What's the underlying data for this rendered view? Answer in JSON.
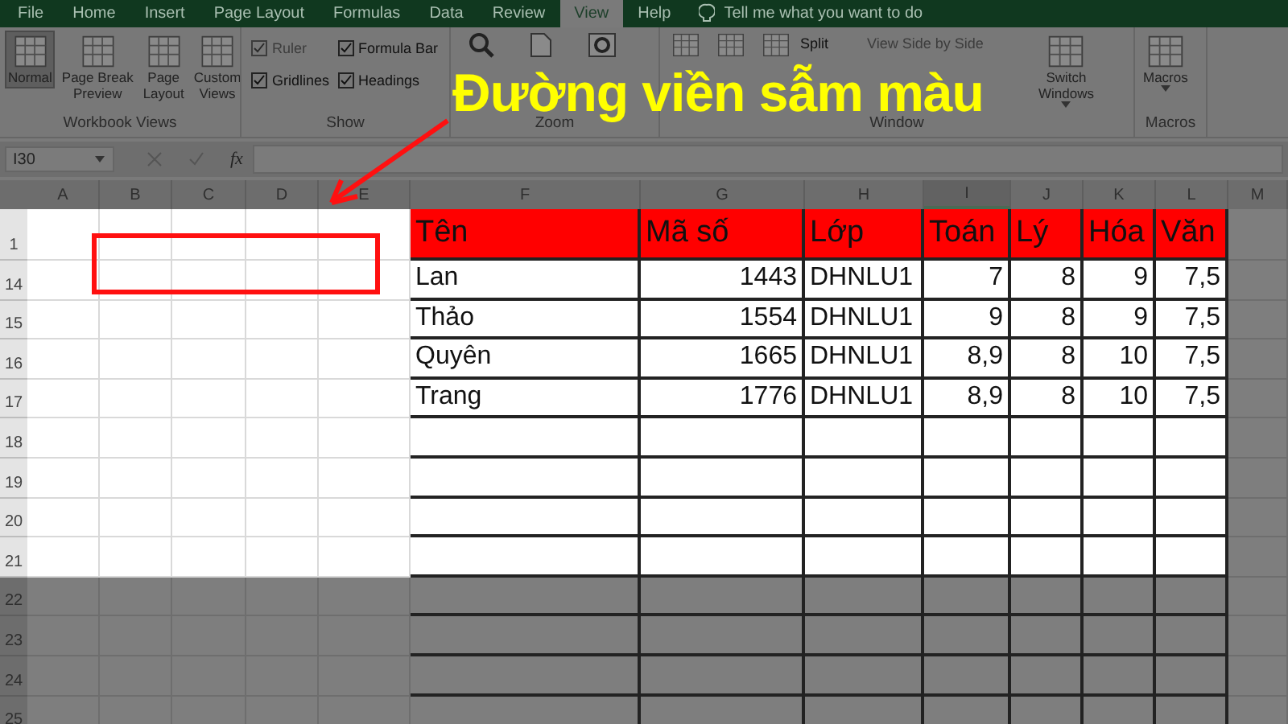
{
  "tabs": [
    {
      "label": "File",
      "selected": false
    },
    {
      "label": "Home",
      "selected": false
    },
    {
      "label": "Insert",
      "selected": false
    },
    {
      "label": "Page Layout",
      "selected": false
    },
    {
      "label": "Formulas",
      "selected": false
    },
    {
      "label": "Data",
      "selected": false
    },
    {
      "label": "Review",
      "selected": false
    },
    {
      "label": "View",
      "selected": true
    },
    {
      "label": "Help",
      "selected": false
    }
  ],
  "tell_me": {
    "placeholder": "Tell me what you want to do"
  },
  "ribbon": {
    "groups": [
      {
        "kind": "views",
        "label": "Workbook Views",
        "items": [
          {
            "lines": [
              "Normal"
            ],
            "selected": true
          },
          {
            "lines": [
              "Page Break",
              "Preview"
            ],
            "selected": false
          },
          {
            "lines": [
              "Page",
              "Layout"
            ],
            "selected": false
          },
          {
            "lines": [
              "Custom",
              "Views"
            ],
            "selected": false
          }
        ]
      },
      {
        "kind": "checks",
        "label": "Show",
        "items": [
          {
            "label": "Ruler",
            "checked": true,
            "disabled": true
          },
          {
            "label": "Formula Bar",
            "checked": true,
            "disabled": false
          },
          {
            "label": "Gridlines",
            "checked": true,
            "disabled": false
          },
          {
            "label": "Headings",
            "checked": true,
            "disabled": false
          }
        ]
      },
      {
        "kind": "zoom",
        "label": "Zoom"
      },
      {
        "kind": "window",
        "label": "Window",
        "items": [
          {
            "label": "Split",
            "disabled": false
          },
          {
            "label": "View Side by Side",
            "disabled": true
          }
        ],
        "button": {
          "lines": [
            "Switch",
            "Windows"
          ]
        }
      },
      {
        "kind": "macros",
        "label": "Macros",
        "button": {
          "lines": [
            "Macros"
          ]
        }
      }
    ]
  },
  "formula_bar": {
    "name_box": "I30",
    "function_label": "fx"
  },
  "columns": [
    {
      "label": "A",
      "selected": false
    },
    {
      "label": "B",
      "selected": false
    },
    {
      "label": "C",
      "selected": false
    },
    {
      "label": "D",
      "selected": false
    },
    {
      "label": "E",
      "selected": false
    },
    {
      "label": "F",
      "selected": false
    },
    {
      "label": "G",
      "selected": false
    },
    {
      "label": "H",
      "selected": false
    },
    {
      "label": "I",
      "selected": true
    },
    {
      "label": "J",
      "selected": false
    },
    {
      "label": "K",
      "selected": false
    },
    {
      "label": "L",
      "selected": false
    },
    {
      "label": "M",
      "selected": false
    }
  ],
  "rows": [
    {
      "label": "1",
      "kind": "header",
      "dimmed": false,
      "cells": [
        "Tên",
        "Mã số",
        "Lớp",
        "Toán",
        "Lý",
        "Hóa",
        "Văn"
      ]
    },
    {
      "label": "14",
      "kind": "data",
      "dimmed": false,
      "cells": [
        "Lan",
        "1443",
        "DHNLU1",
        "7",
        "8",
        "9",
        "7,5"
      ]
    },
    {
      "label": "15",
      "kind": "data",
      "dimmed": false,
      "cells": [
        "Thảo",
        "1554",
        "DHNLU1",
        "9",
        "8",
        "9",
        "7,5"
      ]
    },
    {
      "label": "16",
      "kind": "data",
      "dimmed": false,
      "cells": [
        "Quyên",
        "1665",
        "DHNLU1",
        "8,9",
        "8",
        "10",
        "7,5"
      ]
    },
    {
      "label": "17",
      "kind": "data",
      "dimmed": false,
      "cells": [
        "Trang",
        "1776",
        "DHNLU1",
        "8,9",
        "8",
        "10",
        "7,5"
      ]
    },
    {
      "label": "18",
      "kind": "empty",
      "dimmed": false
    },
    {
      "label": "19",
      "kind": "empty",
      "dimmed": false
    },
    {
      "label": "20",
      "kind": "empty",
      "dimmed": false
    },
    {
      "label": "21",
      "kind": "empty",
      "dimmed": false
    },
    {
      "label": "22",
      "kind": "empty",
      "dimmed": true
    },
    {
      "label": "23",
      "kind": "empty",
      "dimmed": true
    },
    {
      "label": "24",
      "kind": "empty",
      "dimmed": true
    },
    {
      "label": "25",
      "kind": "empty",
      "dimmed": true
    }
  ],
  "annotation": {
    "caption": "Đường viền sẫm màu"
  }
}
